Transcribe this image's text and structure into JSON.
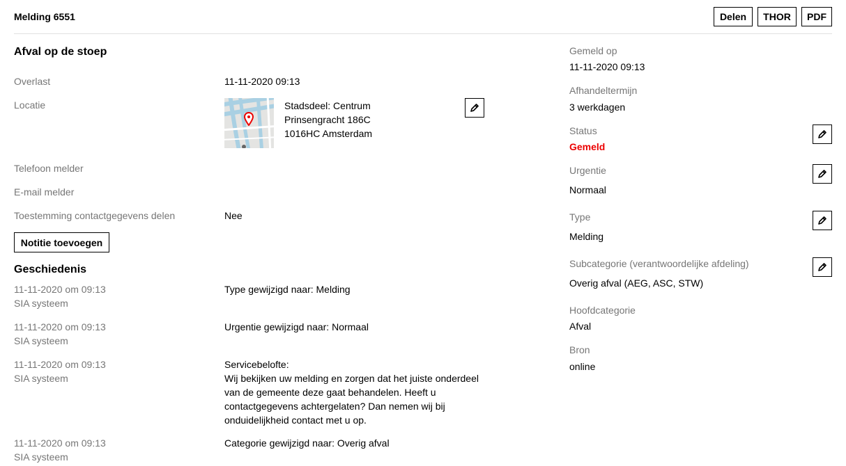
{
  "header": {
    "title": "Melding 6551",
    "buttons": {
      "delen": "Delen",
      "thor": "THOR",
      "pdf": "PDF"
    }
  },
  "main": {
    "title": "Afval op de stoep",
    "overlast": {
      "label": "Overlast",
      "value": "11-11-2020 09:13"
    },
    "locatie": {
      "label": "Locatie",
      "lines": [
        "Stadsdeel: Centrum",
        "Prinsengracht 186C",
        "1016HC Amsterdam"
      ]
    },
    "telefoon": {
      "label": "Telefoon melder",
      "value": ""
    },
    "email": {
      "label": "E-mail melder",
      "value": ""
    },
    "toestemming": {
      "label": "Toestemming contactgegevens delen",
      "value": "Nee"
    },
    "note_button": "Notitie toevoegen"
  },
  "history": {
    "title": "Geschiedenis",
    "items": [
      {
        "date": "11-11-2020 om 09:13",
        "who": "SIA systeem",
        "text": "Type gewijzigd naar: Melding"
      },
      {
        "date": "11-11-2020 om 09:13",
        "who": "SIA systeem",
        "text": "Urgentie gewijzigd naar: Normaal"
      },
      {
        "date": "11-11-2020 om 09:13",
        "who": "SIA systeem",
        "text": "Servicebelofte:\nWij bekijken uw melding en zorgen dat het juiste onderdeel van de gemeente deze gaat behandelen. Heeft u contactgegevens achtergelaten? Dan nemen wij bij onduidelijkheid contact met u op."
      },
      {
        "date": "11-11-2020 om 09:13",
        "who": "SIA systeem",
        "text": "Categorie gewijzigd naar: Overig afval"
      }
    ]
  },
  "side": {
    "gemeld_op": {
      "label": "Gemeld op",
      "value": "11-11-2020 09:13"
    },
    "afhandeltermijn": {
      "label": "Afhandeltermijn",
      "value": "3 werkdagen"
    },
    "status": {
      "label": "Status",
      "value": "Gemeld",
      "color": "#ec0000"
    },
    "urgentie": {
      "label": "Urgentie",
      "value": "Normaal"
    },
    "type": {
      "label": "Type",
      "value": "Melding"
    },
    "subcategorie": {
      "label": "Subcategorie (verantwoordelijke afdeling)",
      "value": "Overig afval (AEG, ASC, STW)"
    },
    "hoofdcategorie": {
      "label": "Hoofdcategorie",
      "value": "Afval"
    },
    "bron": {
      "label": "Bron",
      "value": "online"
    }
  },
  "icons": {
    "edit": "pencil-icon",
    "marker": "map-marker-icon"
  }
}
